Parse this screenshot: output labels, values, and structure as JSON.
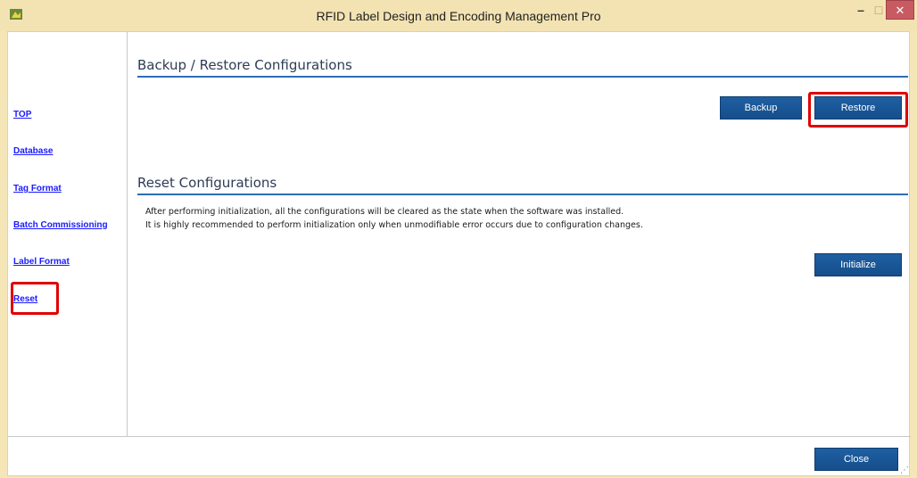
{
  "window": {
    "title": "RFID Label Design and Encoding Management Pro",
    "min_glyph": "–",
    "max_glyph": "□",
    "close_glyph": "✕"
  },
  "sidebar": {
    "items": [
      {
        "label": "TOP"
      },
      {
        "label": "Database"
      },
      {
        "label": "Tag Format"
      },
      {
        "label": "Batch Commissioning"
      },
      {
        "label": "Label Format"
      },
      {
        "label": "Reset"
      }
    ]
  },
  "backup_section": {
    "title": "Backup / Restore Configurations",
    "backup_label": "Backup",
    "restore_label": "Restore"
  },
  "reset_section": {
    "title": "Reset Configurations",
    "line1": "After performing initialization, all the configurations will be cleared as the state when the software was installed.",
    "line2": "It is highly recommended to perform initialization only when unmodifiable error occurs due to configuration changes.",
    "initialize_label": "Initialize"
  },
  "footer": {
    "close_label": "Close"
  },
  "colors": {
    "accent": "#2f6db4",
    "button": "#1f5fa2",
    "highlight": "#e00000",
    "link": "#1a1aff"
  }
}
